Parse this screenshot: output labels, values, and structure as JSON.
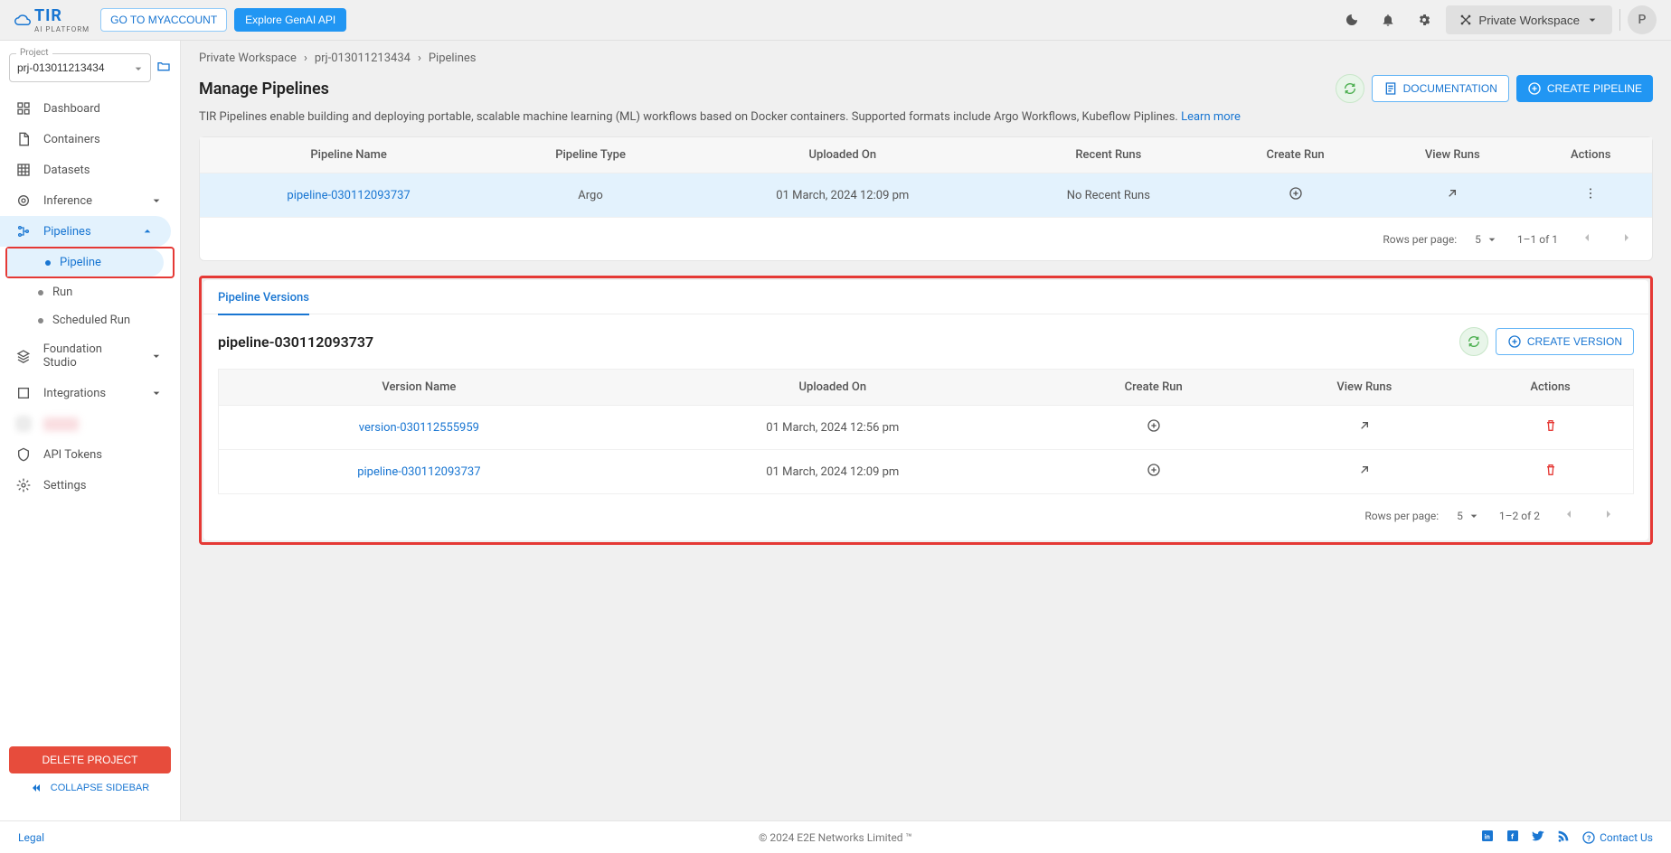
{
  "topbar": {
    "logo_main": "TIR",
    "logo_sub": "AI PLATFORM",
    "myaccount": "GO TO MYACCOUNT",
    "explore": "Explore GenAI API",
    "workspace": "Private Workspace",
    "avatar": "P"
  },
  "sidebar": {
    "project_label": "Project",
    "project_value": "prj-013011213434",
    "items": {
      "dashboard": "Dashboard",
      "containers": "Containers",
      "datasets": "Datasets",
      "inference": "Inference",
      "pipelines": "Pipelines",
      "pipeline": "Pipeline",
      "run": "Run",
      "scheduled_run": "Scheduled Run",
      "foundation": "Foundation Studio",
      "integrations": "Integrations",
      "api_tokens": "API Tokens",
      "settings": "Settings"
    },
    "delete": "DELETE PROJECT",
    "collapse": "COLLAPSE SIDEBAR"
  },
  "breadcrumb": {
    "a": "Private Workspace",
    "b": "prj-013011213434",
    "c": "Pipelines"
  },
  "page": {
    "title": "Manage Pipelines",
    "doc": "DOCUMENTATION",
    "create": "CREATE PIPELINE",
    "desc": "TIR Pipelines enable building and deploying portable, scalable machine learning (ML) workflows based on Docker containers. Supported formats include Argo Workflows, Kubeflow Piplines. ",
    "learn": "Learn more"
  },
  "pipelines_table": {
    "headers": {
      "name": "Pipeline Name",
      "type": "Pipeline Type",
      "uploaded": "Uploaded On",
      "recent": "Recent Runs",
      "create_run": "Create Run",
      "view_runs": "View Runs",
      "actions": "Actions"
    },
    "rows": [
      {
        "name": "pipeline-030112093737",
        "type": "Argo",
        "uploaded": "01 March, 2024 12:09 pm",
        "recent": "No Recent Runs"
      }
    ],
    "pagination": {
      "label": "Rows per page:",
      "per": "5",
      "range": "1–1 of 1"
    }
  },
  "versions": {
    "tab": "Pipeline Versions",
    "title": "pipeline-030112093737",
    "create": "CREATE VERSION",
    "headers": {
      "name": "Version Name",
      "uploaded": "Uploaded On",
      "create_run": "Create Run",
      "view_runs": "View Runs",
      "actions": "Actions"
    },
    "rows": [
      {
        "name": "version-030112555959",
        "uploaded": "01 March, 2024 12:56 pm"
      },
      {
        "name": "pipeline-030112093737",
        "uploaded": "01 March, 2024 12:09 pm"
      }
    ],
    "pagination": {
      "label": "Rows per page:",
      "per": "5",
      "range": "1–2 of 2"
    }
  },
  "footer": {
    "legal": "Legal",
    "copy": "© 2024 E2E Networks Limited ™",
    "contact": "Contact Us"
  }
}
